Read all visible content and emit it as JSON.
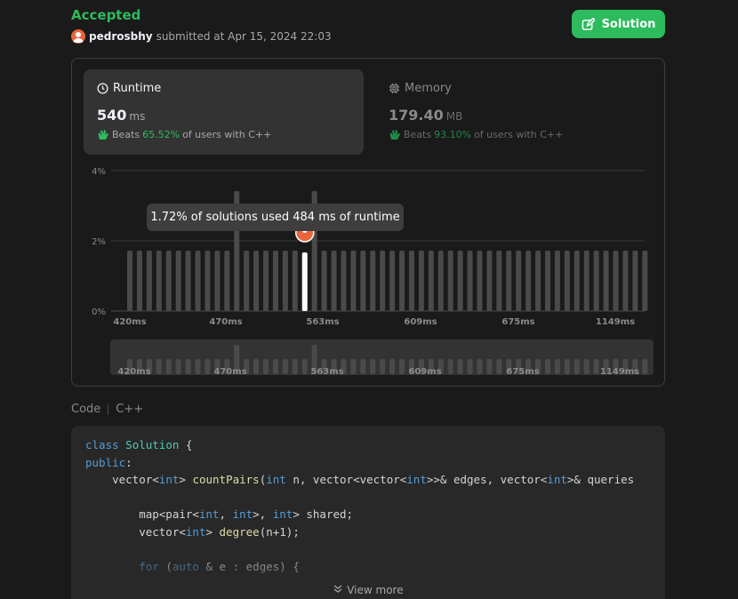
{
  "header": {
    "status": "Accepted",
    "username": "pedrosbhy",
    "submitted_text": "submitted at Apr 15, 2024 22:03",
    "solution_label": "Solution"
  },
  "runtime_card": {
    "title": "Runtime",
    "value": "540",
    "unit": "ms",
    "beats_label": "Beats",
    "beats_pct": "65.52%",
    "beats_suffix": "of users with C++"
  },
  "memory_card": {
    "title": "Memory",
    "value": "179.40",
    "unit": "MB",
    "beats_label": "Beats",
    "beats_pct": "93.10%",
    "beats_suffix": "of users with C++"
  },
  "chart_data": {
    "type": "bar",
    "y_ticks": [
      "4%",
      "2%",
      "0%"
    ],
    "ylim": [
      0,
      4
    ],
    "x_tick_labels": [
      "420ms",
      "470ms",
      "563ms",
      "609ms",
      "675ms",
      "1149ms"
    ],
    "grid": true,
    "values": [
      1.72,
      1.72,
      1.72,
      1.72,
      1.72,
      1.72,
      1.72,
      1.72,
      1.72,
      1.72,
      1.72,
      3.4,
      1.72,
      1.72,
      1.72,
      1.72,
      1.72,
      1.72,
      1.72,
      3.4,
      1.72,
      1.72,
      1.72,
      1.72,
      1.72,
      1.72,
      1.72,
      1.72,
      1.72,
      1.72,
      1.72,
      1.72,
      1.72,
      1.72,
      1.72,
      1.72,
      1.72,
      1.72,
      1.72,
      1.72,
      1.72,
      1.72,
      1.72,
      1.72,
      1.72,
      1.72,
      1.72,
      1.72,
      1.72,
      1.72,
      1.72,
      1.72,
      1.72,
      1.72
    ],
    "highlight_index": 18,
    "tooltip": "1.72% of solutions used 484 ms of runtime"
  },
  "code_section": {
    "label": "Code",
    "language": "C++",
    "view_more": "View more"
  },
  "colors": {
    "accent_green": "#2cbb5d",
    "bar": "#4a4a4a",
    "bar_highlight": "#ffffff"
  }
}
